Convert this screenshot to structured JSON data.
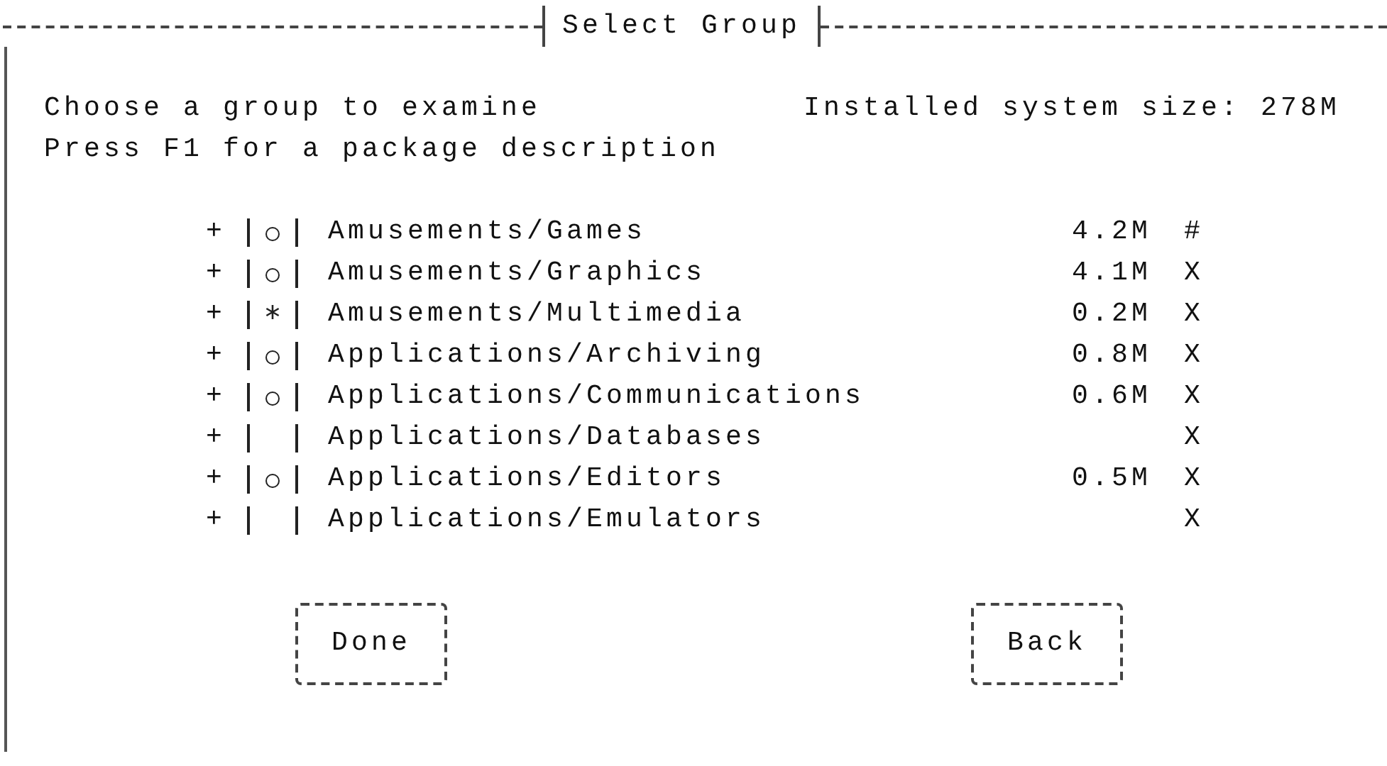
{
  "dialog": {
    "title": "Select Group",
    "prompt": "Choose a group to examine",
    "system_size": "Installed system size: 278M",
    "hint": "Press F1 for a package description"
  },
  "groups": [
    {
      "expander": "+",
      "checked": false,
      "partial": true,
      "name": "Amusements/Games",
      "size": "4.2M",
      "flag": "#"
    },
    {
      "expander": "+",
      "checked": false,
      "partial": true,
      "name": "Amusements/Graphics",
      "size": "4.1M",
      "flag": "X"
    },
    {
      "expander": "+",
      "checked": true,
      "partial": false,
      "name": "Amusements/Multimedia",
      "size": "0.2M",
      "flag": "X"
    },
    {
      "expander": "+",
      "checked": false,
      "partial": true,
      "name": "Applications/Archiving",
      "size": "0.8M",
      "flag": "X"
    },
    {
      "expander": "+",
      "checked": false,
      "partial": true,
      "name": "Applications/Communications",
      "size": "0.6M",
      "flag": "X"
    },
    {
      "expander": "+",
      "checked": false,
      "partial": false,
      "name": "Applications/Databases",
      "flag": "X"
    },
    {
      "expander": "+",
      "checked": false,
      "partial": true,
      "name": "Applications/Editors",
      "size": "0.5M",
      "flag": "X"
    },
    {
      "expander": "+",
      "checked": false,
      "partial": false,
      "name": "Applications/Emulators",
      "flag": "X"
    }
  ],
  "buttons": [
    "Done",
    "Back"
  ]
}
